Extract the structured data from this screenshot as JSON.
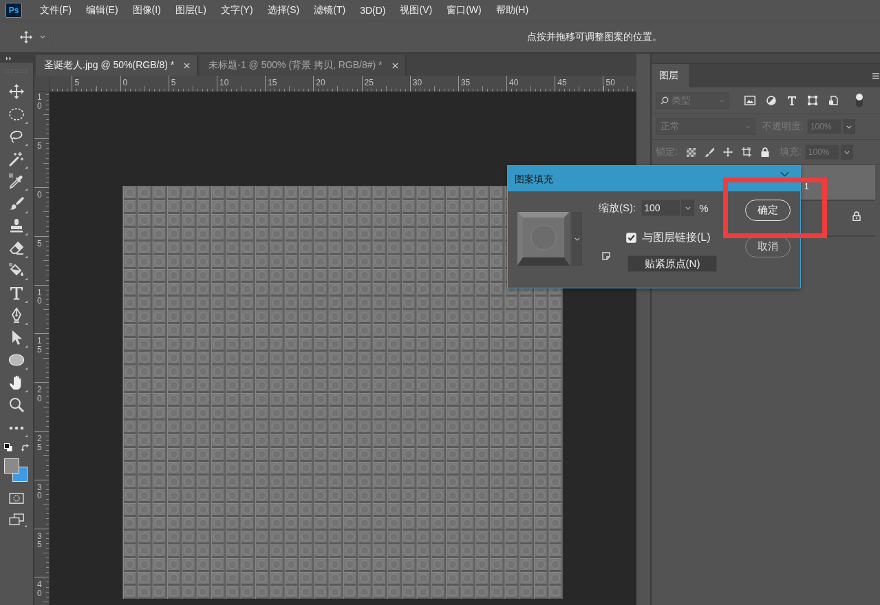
{
  "app": {
    "logo": "Ps"
  },
  "menu": [
    "文件(F)",
    "编辑(E)",
    "图像(I)",
    "图层(L)",
    "文字(Y)",
    "选择(S)",
    "滤镜(T)",
    "3D(D)",
    "视图(V)",
    "窗口(W)",
    "帮助(H)"
  ],
  "options_bar": {
    "hint": "点按并拖移可调整图案的位置。"
  },
  "toolbar": {
    "color_swatches": [
      {
        "kind": "background",
        "color": "#3d9ae6"
      },
      {
        "kind": "foreground",
        "color": "#8a8a8a"
      }
    ]
  },
  "document_tabs": [
    {
      "label": "圣诞老人.jpg @ 50%(RGB/8) *",
      "selected": true
    },
    {
      "label": "未标题-1 @ 500% (背景 拷贝, RGB/8#) *",
      "selected": false
    }
  ],
  "rulers": {
    "horizontal": [
      "5",
      "0",
      "5",
      "10",
      "15",
      "20",
      "25",
      "30",
      "35",
      "40",
      "45",
      "50"
    ],
    "vertical": [
      "10",
      "5",
      "0",
      "5",
      "10",
      "15",
      "20",
      "25",
      "30",
      "35",
      "40"
    ]
  },
  "layers_panel": {
    "tab": "图层",
    "disabled": true,
    "filter_kind": "类型",
    "filter_toggle": {
      "on": false
    },
    "blend_mode": "正常",
    "opacity_label": "不透明度:",
    "opacity": "100%",
    "lock_label": "锁定:",
    "fill_label": "填充:",
    "fill": "100%",
    "layers": [
      {
        "name": "1",
        "selected": true,
        "locked": false
      },
      {
        "selected": false,
        "locked": true
      }
    ]
  },
  "dialog": {
    "title": "图案填充",
    "scale_label": "缩放(S):",
    "scale": "100",
    "unit": "%",
    "link_with_layer": {
      "label": "与图层链接(L)",
      "checked": true
    },
    "snap_button": "贴紧原点(N)",
    "buttons": [
      {
        "label": "确定",
        "kind": "primary"
      },
      {
        "label": "取消",
        "kind": "secondary"
      }
    ]
  },
  "highlight": {
    "kind": "rectangle"
  }
}
